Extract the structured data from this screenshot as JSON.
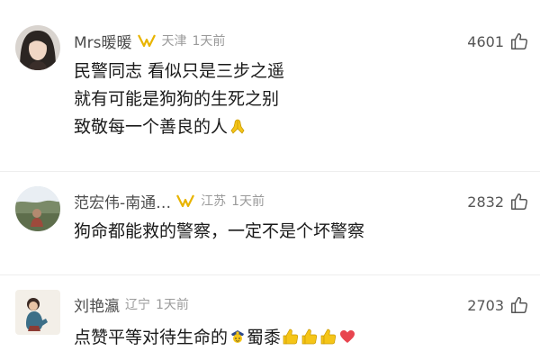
{
  "comments": [
    {
      "username": "Mrs暖暖",
      "location": "天津",
      "time": "1天前",
      "likes": "4601",
      "lines": [
        "民警同志  看似只是三步之遥",
        "就有可能是狗狗的生死之别",
        "致敬每一个善良的人"
      ]
    },
    {
      "username": "范宏伟-南通…",
      "location": "江苏",
      "time": "1天前",
      "likes": "2832",
      "lines": [
        "狗命都能救的警察，一定不是个坏警察"
      ]
    },
    {
      "username": "刘艳瀛",
      "location": "辽宁",
      "time": "1天前",
      "likes": "2703",
      "lines": [
        "点赞平等对待生命的",
        "蜀黍"
      ]
    }
  ],
  "icons": {
    "vip": "vip-badge-icon",
    "like": "thumbs-up-icon",
    "pray": "praying-hands-emoji",
    "police": "police-officer-emoji",
    "thumb_emoji": "thumbs-up-emoji",
    "heart": "red-heart-emoji"
  },
  "colors": {
    "vip_gold": "#e8b400",
    "heart": "#e8454f",
    "thumb_yellow": "#f5c518"
  }
}
